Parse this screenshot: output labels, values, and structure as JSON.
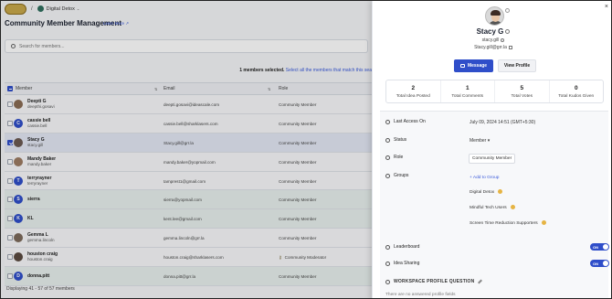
{
  "breadcrumb": {
    "separator": "/",
    "workspace": "Digital Detox",
    "caret": "⌄"
  },
  "page": {
    "title": "Community Member Management",
    "learn_more": "Learn More"
  },
  "search": {
    "placeholder": "Search for members..."
  },
  "selection": {
    "count_text": "1 members selected.",
    "select_all_text": "Select all the members that match this sea"
  },
  "table": {
    "columns": {
      "member": "Member",
      "email": "Email",
      "role": "Role"
    },
    "rows": [
      {
        "name": "Deepti G",
        "handle": "deepthi.gosavi",
        "email": "deepti.gosavi@ideascale.com",
        "role": "Community Member",
        "initial": "",
        "avatar_color": "#8a6d55",
        "checked": false,
        "tinted": false
      },
      {
        "name": "cassie bell",
        "handle": "cassie.bell",
        "email": "cassie.bell@sharklasers.com",
        "role": "Community Member",
        "initial": "C",
        "avatar_color": "#2f4ec9",
        "checked": false,
        "tinted": false
      },
      {
        "name": "Stacy G",
        "handle": "stacy.gill",
        "email": "Stacy.gill@grr.la",
        "role": "Community Member",
        "initial": "",
        "avatar_color": "#6b5a52",
        "checked": true,
        "tinted": false
      },
      {
        "name": "Mandy Baker",
        "handle": "mandy.baker",
        "email": "mandy.baker@yopmail.com",
        "role": "Community Member",
        "initial": "",
        "avatar_color": "#9c7b62",
        "checked": false,
        "tinted": false
      },
      {
        "name": "terryrayner",
        "handle": "terryrayner",
        "email": "tamprest1@gmail.com",
        "role": "Community Member",
        "initial": "T",
        "avatar_color": "#2f4ec9",
        "checked": false,
        "tinted": false
      },
      {
        "name": "sierra",
        "handle": "",
        "email": "sierra@yopmail.com",
        "role": "Community Member",
        "initial": "S",
        "avatar_color": "#2f4ec9",
        "checked": false,
        "tinted": true
      },
      {
        "name": "KL",
        "handle": "",
        "email": "kent.lee@gmail.com",
        "role": "Community Member",
        "initial": "K",
        "avatar_color": "#2f4ec9",
        "checked": false,
        "tinted": true
      },
      {
        "name": "Gemma L",
        "handle": "gemma.lincoln",
        "email": "gemma.lincoln@grr.la",
        "role": "Community Member",
        "initial": "",
        "avatar_color": "#7d6a5c",
        "checked": false,
        "tinted": false
      },
      {
        "name": "houston craig",
        "handle": "houston.craig",
        "email": "houston.craig@sharklasers.com",
        "role": "Community Moderator",
        "initial": "",
        "avatar_color": "#5b4a40",
        "checked": false,
        "tinted": false,
        "moderator": true
      },
      {
        "name": "donna.pitt",
        "handle": "",
        "email": "donna.pitt@grr.la",
        "role": "Community Member",
        "initial": "D",
        "avatar_color": "#2f4ec9",
        "checked": false,
        "tinted": true
      }
    ]
  },
  "footer": {
    "text": "Displaying 41 - 57 of 57 members"
  },
  "panel": {
    "close": "×",
    "name": "Stacy G",
    "handle": "stacy.gill",
    "email": "Stacy.gill@grr.la",
    "message_button": "Message",
    "view_profile_button": "View Profile",
    "stats": [
      {
        "value": "2",
        "label": "Total Idea Posted"
      },
      {
        "value": "1",
        "label": "Total Comments"
      },
      {
        "value": "5",
        "label": "Total Votes"
      },
      {
        "value": "0",
        "label": "Total Kudos Given"
      }
    ],
    "last_access_label": "Last Access On",
    "last_access_value": "July 09, 2024 14:51 (GMT+5:30)",
    "status_label": "Status",
    "status_value": "Member ▾",
    "role_label": "Role",
    "role_value": "Community Member",
    "groups_label": "Groups",
    "add_group": "+ Add to Group",
    "groups": [
      "Digital Detox",
      "Mindful Tech Users",
      "Screen Time Reduction Supporters"
    ],
    "leaderboard_label": "Leaderboard",
    "leaderboard_toggle": "ON",
    "idea_sharing_label": "Idea Sharing",
    "idea_sharing_toggle": "ON",
    "wpq_label": "WORKSPACE PROFILE QUESTION",
    "no_fields": "There are no answered profile fields"
  },
  "colors": {
    "accent": "#2f4ec9",
    "link": "#3b5bdb"
  }
}
